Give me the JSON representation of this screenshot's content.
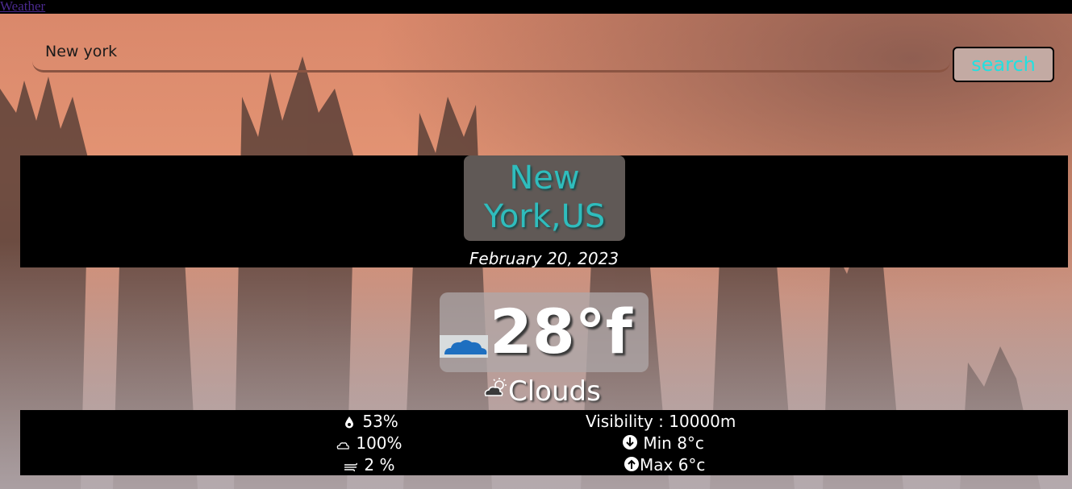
{
  "nav": {
    "title_link": "Weather"
  },
  "search": {
    "value": "New york",
    "button_label": "search"
  },
  "location": {
    "city_line1": "New",
    "city_line2": "York,US",
    "date": "February 20, 2023"
  },
  "current": {
    "temperature": "28°f",
    "condition": "Clouds",
    "condition_icon": "partly-cloudy-icon",
    "weather_image_icon": "cloud-icon"
  },
  "stats": {
    "humidity": "53%",
    "cloudiness": "100%",
    "wind": "2 %",
    "visibility": "Visibility : 10000m",
    "min_temp": "Min 8°c",
    "max_temp": "Max 6°c"
  },
  "colors": {
    "city_text": "#2fbdbd",
    "search_text": "#22e0e0",
    "band": "#000000"
  }
}
